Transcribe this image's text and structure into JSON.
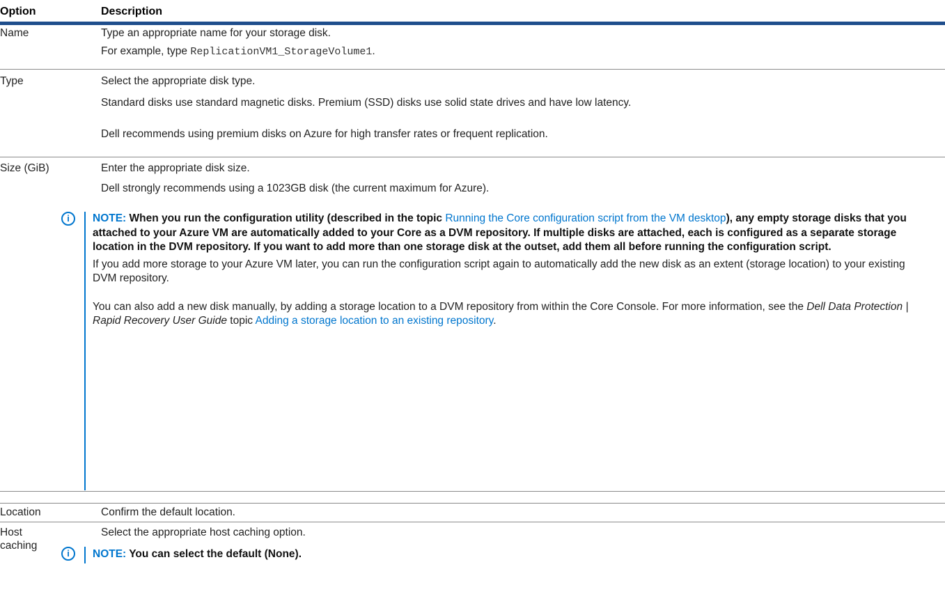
{
  "header": {
    "option": "Option",
    "description": "Description"
  },
  "rows": {
    "name": {
      "option": "Name",
      "line1": "Type an appropriate name for your storage disk.",
      "line2_prefix": "For example, type ",
      "line2_code": "ReplicationVM1_StorageVolume1",
      "line2_suffix": "."
    },
    "type": {
      "option": "Type",
      "line1": "Select the appropriate disk type.",
      "line2": "Standard disks use standard magnetic disks. Premium (SSD) disks use solid state drives and have low latency.",
      "line3": "Dell recommends using premium disks on Azure for high transfer rates or frequent replication."
    },
    "size": {
      "option": "Size (GiB)",
      "line1": "Enter the appropriate disk size.",
      "line2": "Dell strongly recommends using a 1023GB disk (the current maximum for Azure).",
      "note": {
        "label": "NOTE:",
        "text_a": " When you run the configuration utility (described in the topic ",
        "link1": "Running the Core configuration script from the VM desktop",
        "text_b": "), any empty storage disks that you attached to your Azure VM are automatically added to your Core as a DVM repository. If multiple disks are attached, each is configured as a separate storage location in the DVM repository. If you want to add more than one storage disk at the outset, add them all before running the configuration script.",
        "para2": "If you add more storage to your Azure VM later, you can run the configuration script again to automatically add the new disk as an extent (storage location) to your existing DVM repository.",
        "para3_a": "You can also add a new disk manually, by adding a storage location to a DVM repository from within the Core Console. For more information, see the ",
        "para3_em": "Dell Data Protection | Rapid Recovery User Guide",
        "para3_b": " topic ",
        "link2": "Adding a storage location to an existing repository",
        "para3_c": "."
      }
    },
    "location": {
      "option": "Location",
      "line1": "Confirm the default location."
    },
    "host": {
      "option_line1": "Host",
      "option_line2": "caching",
      "line1": "Select the appropriate host caching option.",
      "note_label": "NOTE:",
      "note_text": " You can select the default (None)."
    }
  },
  "icons": {
    "note": "info-icon"
  },
  "colors": {
    "accent": "#0076ce",
    "header_rule": "#1f4e8c"
  }
}
